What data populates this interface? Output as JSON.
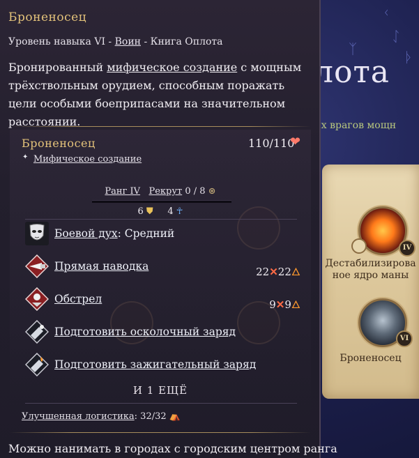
{
  "background": {
    "title_fragment": "лота",
    "subtitle_fragment": "ощих врагов мощн",
    "runes": [
      "ᚲ",
      "ᛇ",
      "ᚦ",
      "ᛉ"
    ],
    "cards": [
      {
        "label": "Дестабилизирова ное ядро маны",
        "rank": "IV"
      },
      {
        "label": "Броненосец",
        "rank": "VI"
      }
    ]
  },
  "tooltip": {
    "title": "Броненосец",
    "meta": {
      "prefix": "Уровень навыка VI",
      "sep1": " - ",
      "class_link": "Воин",
      "sep2": " - ",
      "book": "Книга Оплота"
    },
    "description": {
      "part1": "Бронированный ",
      "link": "мифическое создание",
      "part2": " с мощным трёхствольным орудием, способным поражать цели особыми боеприпасами на значительном расстоянии."
    },
    "unit": {
      "name": "Броненосец",
      "hp": "110/110",
      "type_icon": "✦",
      "type": "Мифическое создание",
      "rank": "Ранг IV",
      "recruit_label": "Рекрут",
      "recruit_value": " 0 / 8",
      "defense": "6",
      "resistance": "4",
      "morale_label": "Боевой дух",
      "morale_value": ": Средний",
      "abilities": [
        {
          "name": "Прямая наводка",
          "dmg1": "22",
          "dmg2": "22"
        },
        {
          "name": "Обстрел",
          "dmg1": "9",
          "dmg2": "9"
        },
        {
          "name": "Подготовить осколочный заряд"
        },
        {
          "name": "Подготовить зажигательный заряд"
        }
      ],
      "more": "И 1 ЕЩЁ",
      "logistics_label": "Улучшенная логистика",
      "logistics_value": ": 32/32"
    },
    "footer": "Можно нанимать в городах с городским центром ранга"
  }
}
